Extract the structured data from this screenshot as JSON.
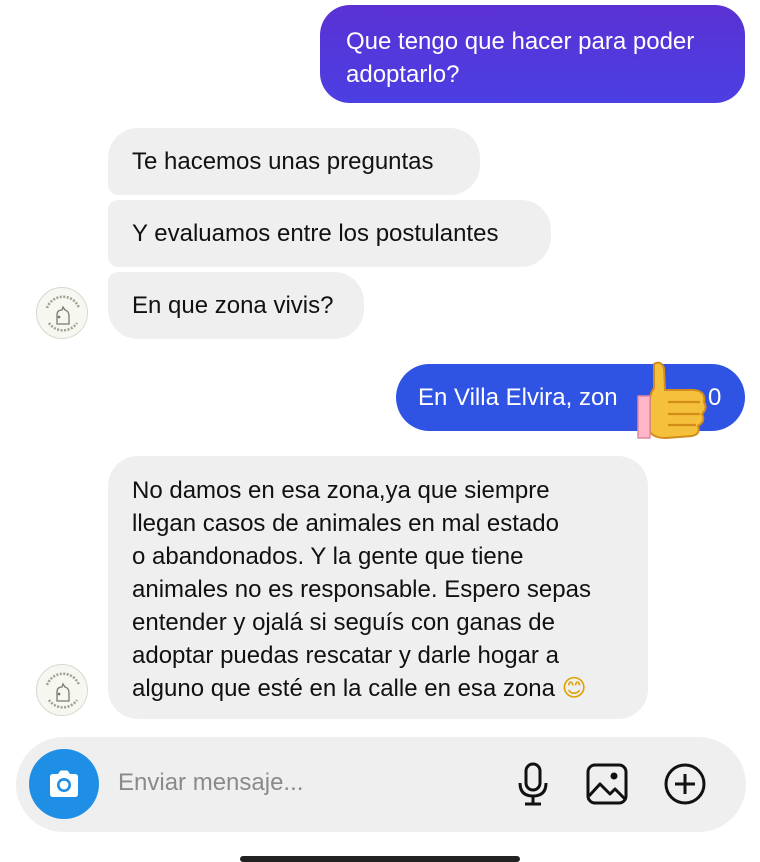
{
  "messages": [
    {
      "id": "m1",
      "from": "me",
      "lines": [
        "Que tengo que hacer para poder",
        "adoptarlo?"
      ]
    },
    {
      "id": "m2",
      "from": "them",
      "lines": [
        "Te hacemos unas preguntas"
      ]
    },
    {
      "id": "m3",
      "from": "them",
      "lines": [
        "Y evaluamos entre los postulantes"
      ]
    },
    {
      "id": "m4",
      "from": "them",
      "lines": [
        "En que zona vivis?"
      ]
    },
    {
      "id": "m5",
      "from": "me",
      "lines": [
        "En Villa Elvira,  zon",
        "0"
      ]
    },
    {
      "id": "m6",
      "from": "them",
      "lines": [
        "No damos en esa zona,ya que siempre",
        "llegan casos de animales en mal estado",
        "o abandonados. Y la gente que tiene",
        "animales no es responsable. Espero sepas",
        "entender y ojalá si seguís con ganas de",
        "adoptar puedas rescatar y darle hogar a",
        "alguno que esté en la calle en esa zona"
      ],
      "emoji": "😊"
    }
  ],
  "avatar": {
    "label": "RESCATANDO HUELLITAS LP"
  },
  "composer": {
    "placeholder": "Enviar mensaje..."
  },
  "icons": {
    "camera": "camera-icon",
    "mic": "microphone-icon",
    "gallery": "gallery-icon",
    "add": "add-icon",
    "thumb": "thumbs-up-emoji"
  },
  "colors": {
    "sent_top": "#4c37d8",
    "sent_bottom": "#2b57e8",
    "received": "#efefef",
    "camera": "#1f8fe6"
  }
}
